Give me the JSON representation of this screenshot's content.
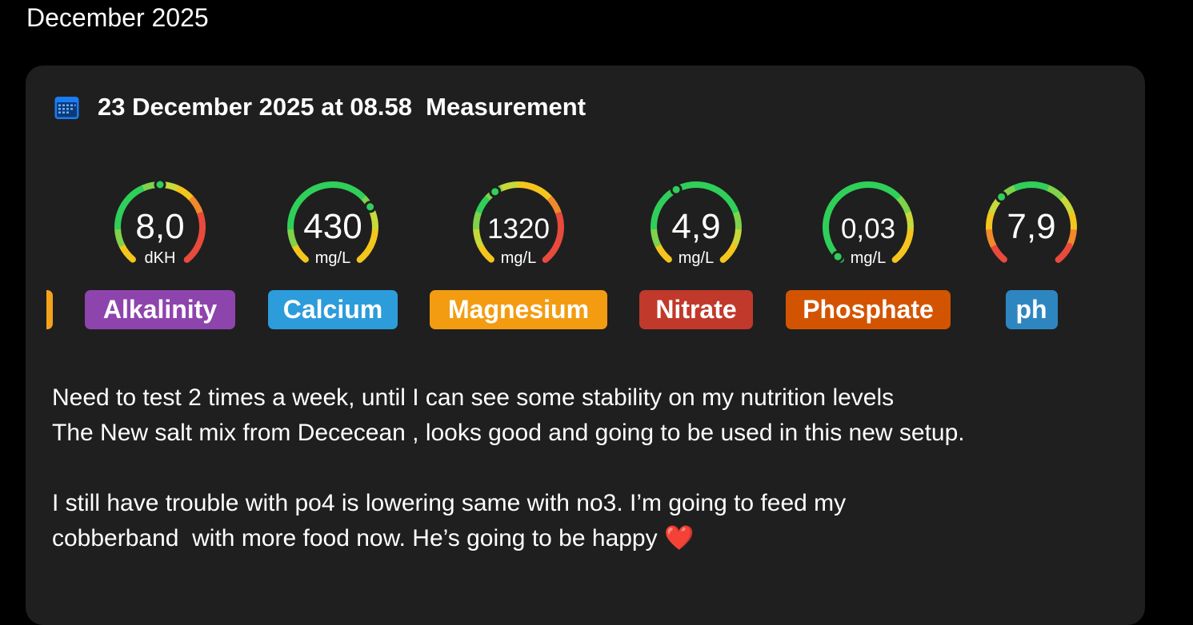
{
  "month_header": "December 2025",
  "card": {
    "title": "23 December 2025 at 08.58  Measurement",
    "gauges": [
      {
        "value": "8,0",
        "unit": "dKH",
        "label": "Alkalinity",
        "badge_color": "#8e44ad",
        "position_fraction": 0.5
      },
      {
        "value": "430",
        "unit": "mg/L",
        "label": "Calcium",
        "badge_color": "#2d9cdb",
        "position_fraction": 0.72
      },
      {
        "value": "1320",
        "unit": "mg/L",
        "label": "Magnesium",
        "badge_color": "#f39c12",
        "position_fraction": 0.38
      },
      {
        "value": "4,9",
        "unit": "mg/L",
        "label": "Nitrate",
        "badge_color": "#c0392b",
        "position_fraction": 0.4
      },
      {
        "value": "0,03",
        "unit": "mg/L",
        "label": "Phosphate",
        "badge_color": "#d35400",
        "position_fraction": 0.02
      },
      {
        "value": "7,9",
        "unit": "",
        "label": "ph",
        "badge_color": "#2e86c1",
        "position_fraction": 0.34
      }
    ],
    "notes": [
      "Need to test 2 times a week, until I can see some stability on my nutrition levels",
      "The New salt mix from Dececean , looks good and going to be used in this new setup.",
      "",
      "I still have trouble with po4 is lowering same with no3. I’m going to feed my",
      "cobberband  with more food now. He’s going to be happy ❤️"
    ],
    "calendar_icon": "calendar-icon",
    "accent_color": "#1a7cf2"
  }
}
